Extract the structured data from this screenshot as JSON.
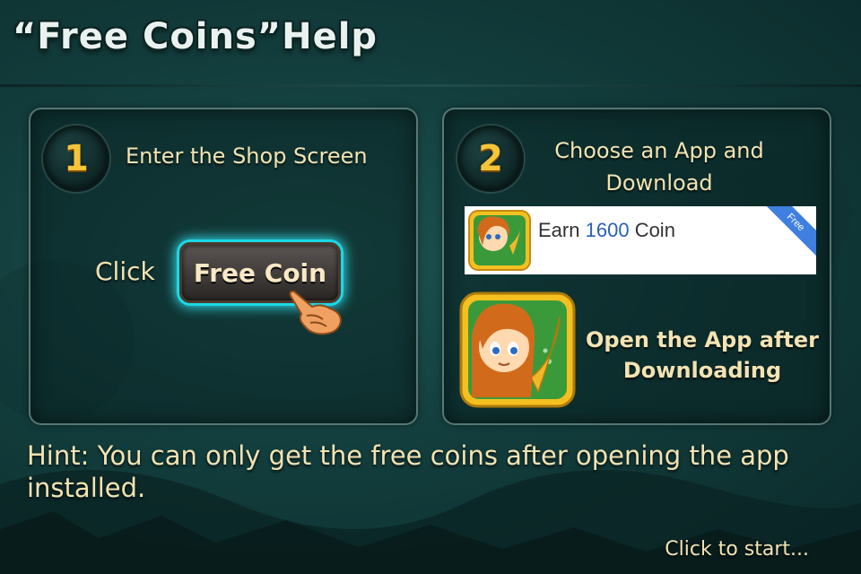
{
  "title": "“Free Coins”Help",
  "step1": {
    "number": "1",
    "text": "Enter the Shop Screen",
    "click_label": "Click",
    "button_label": "Free Coin"
  },
  "step2": {
    "number": "2",
    "text_line1": "Choose an App and",
    "text_line2": "Download",
    "ad": {
      "earn_label": "Earn",
      "amount": "1600",
      "unit": "Coin",
      "ribbon": "Free"
    },
    "open_line1": "Open the App after",
    "open_line2": "Downloading"
  },
  "hint": "Hint: You can only get the free coins after opening the app installed.",
  "start_label": "Click to start...",
  "colors": {
    "text_cream": "#f2e3b3",
    "step_number": "#f4c43a",
    "glow_cyan": "#35e4f2",
    "amount_blue": "#2b5fb8"
  }
}
